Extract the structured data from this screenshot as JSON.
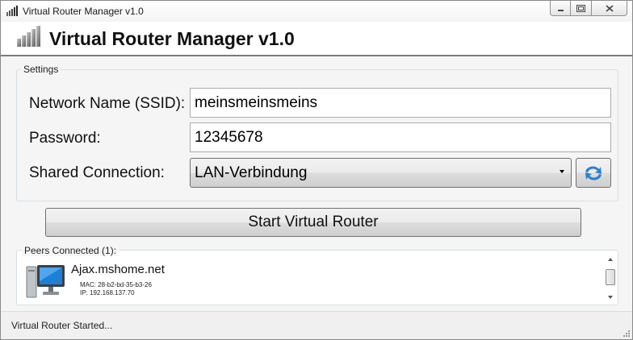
{
  "window": {
    "title": "Virtual Router Manager v1.0",
    "icon": "router-icon",
    "controls": [
      "minimize-icon",
      "maximize-icon",
      "close-icon"
    ]
  },
  "header": {
    "title": "Virtual Router Manager v1.0",
    "icon": "router-icon"
  },
  "settings": {
    "group_label": "Settings",
    "ssid_label": "Network Name (SSID):",
    "ssid_value": "meinsmeinsmeins",
    "password_label": "Password:",
    "password_value": "12345678",
    "shared_label": "Shared Connection:",
    "shared_value": "LAN-Verbindung",
    "refresh_icon": "refresh-icon"
  },
  "start_button": {
    "label": "Start Virtual Router"
  },
  "peers": {
    "label": "Peers Connected (1):",
    "items": [
      {
        "name": "Ajax.mshome.net",
        "mac": "MAC: 28-b2-bd-35-b3-26",
        "ip": "IP: 192.168.137.70",
        "icon": "computer-icon"
      }
    ]
  },
  "status": {
    "text": "Virtual Router Started..."
  },
  "colors": {
    "accent_blue": "#2a7fd4",
    "border": "#707070"
  }
}
